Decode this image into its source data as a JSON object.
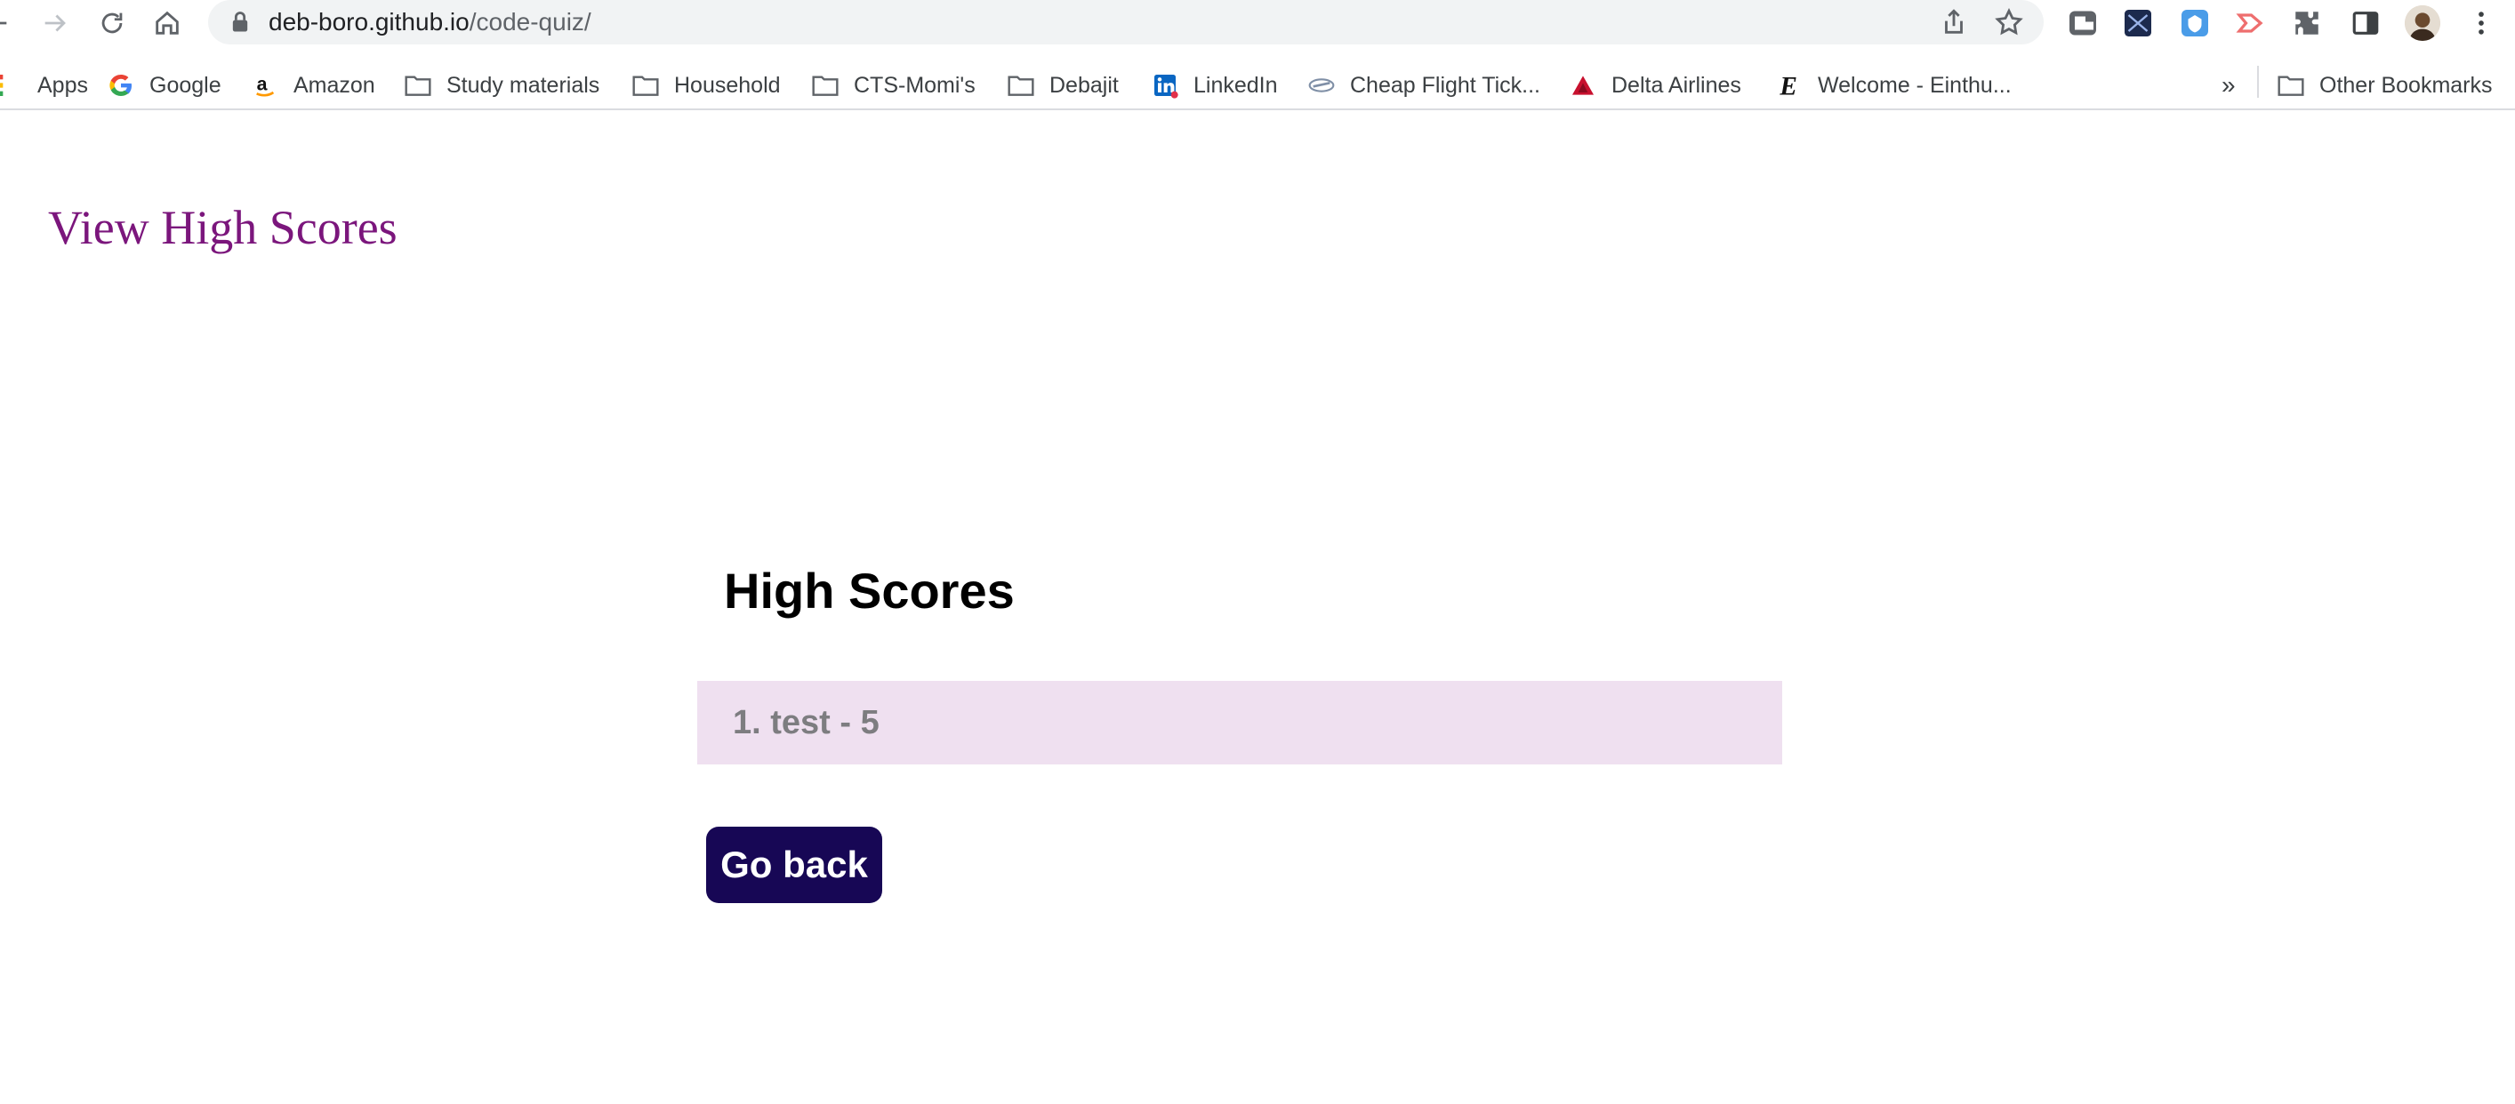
{
  "browser": {
    "url_host": "deb-boro.github.io",
    "url_path": "/code-quiz/",
    "bookmarks": [
      {
        "label": "Apps",
        "icon": "apps-grid-icon"
      },
      {
        "label": "Google",
        "icon": "google-icon"
      },
      {
        "label": "Amazon",
        "icon": "amazon-icon"
      },
      {
        "label": "Study materials",
        "icon": "folder-icon"
      },
      {
        "label": "Household",
        "icon": "folder-icon"
      },
      {
        "label": "CTS-Momi's",
        "icon": "folder-icon"
      },
      {
        "label": "Debajit",
        "icon": "folder-icon"
      },
      {
        "label": "LinkedIn",
        "icon": "linkedin-icon"
      },
      {
        "label": "Cheap Flight Tick...",
        "icon": "plane-icon"
      },
      {
        "label": "Delta Airlines",
        "icon": "delta-icon"
      },
      {
        "label": "Welcome - Einthu...",
        "icon": "einthusan-icon"
      }
    ],
    "overflow_label": "»",
    "other_bookmarks": "Other Bookmarks"
  },
  "page": {
    "view_high_scores": "View High Scores",
    "title": "High Scores",
    "scores": [
      {
        "text": "1. test - 5"
      }
    ],
    "go_back_label": "Go back"
  },
  "colors": {
    "link": "#7b167c",
    "score_bg": "#efe0f0",
    "button_bg": "#170755"
  }
}
